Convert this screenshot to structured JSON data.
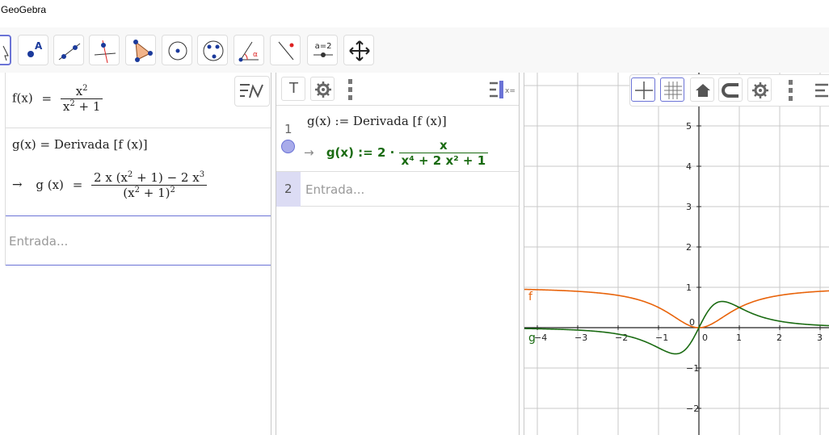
{
  "window": {
    "title": "GeoGebra"
  },
  "toolbar": {
    "tools": [
      {
        "name": "move-tool-icon",
        "active": true
      },
      {
        "name": "point-tool-icon"
      },
      {
        "name": "line-tool-icon"
      },
      {
        "name": "perpendicular-line-tool-icon"
      },
      {
        "name": "polygon-tool-icon"
      },
      {
        "name": "circle-center-point-tool-icon"
      },
      {
        "name": "circle-three-points-tool-icon"
      },
      {
        "name": "angle-tool-icon"
      },
      {
        "name": "reflect-tool-icon"
      },
      {
        "name": "slider-tool-icon",
        "label": "a=2"
      },
      {
        "name": "move-graphics-view-tool-icon"
      }
    ]
  },
  "cas": {
    "row1": {
      "f": "f(x)",
      "eq": "=",
      "num": "x",
      "sup": "2",
      "den_a": "x",
      "den_b": "2",
      "den_c": "+ 1"
    },
    "row2": {
      "input": "g(x) = Derivada [f (x)]",
      "arrow": "→",
      "lhs": "g (x)",
      "eq": "=",
      "num_a": "2 x",
      "num_b": "(x",
      "num_c": "+ 1) − 2 x",
      "sup2": "2",
      "sup3": "3",
      "den_a": "(x",
      "den_b": "+ 1)",
      "den_sup": "2"
    },
    "input_placeholder": "Entrada..."
  },
  "algebra": {
    "header": {
      "text_icon": "T"
    },
    "rows": [
      {
        "number": "1",
        "input": "g(x) := Derivada [f (x)]",
        "arrow": "→",
        "output_lhs": "g(x)  :=  2 ·",
        "output_num": "x",
        "output_den": "x⁴ + 2 x² + 1"
      },
      {
        "number": "2",
        "placeholder": "Entrada..."
      }
    ]
  },
  "graph": {
    "x_ticks": [
      "−4",
      "−3",
      "−2",
      "−1",
      "0",
      "1",
      "2",
      "3"
    ],
    "y_ticks": [
      "5",
      "4",
      "3",
      "2",
      "1",
      "−1",
      "−2"
    ],
    "origin_label": "0",
    "function_labels": {
      "f": "f",
      "g": "g"
    },
    "colors": {
      "f": "#e8630a",
      "g": "#1a6b12",
      "accent": "#6b73d6"
    }
  }
}
